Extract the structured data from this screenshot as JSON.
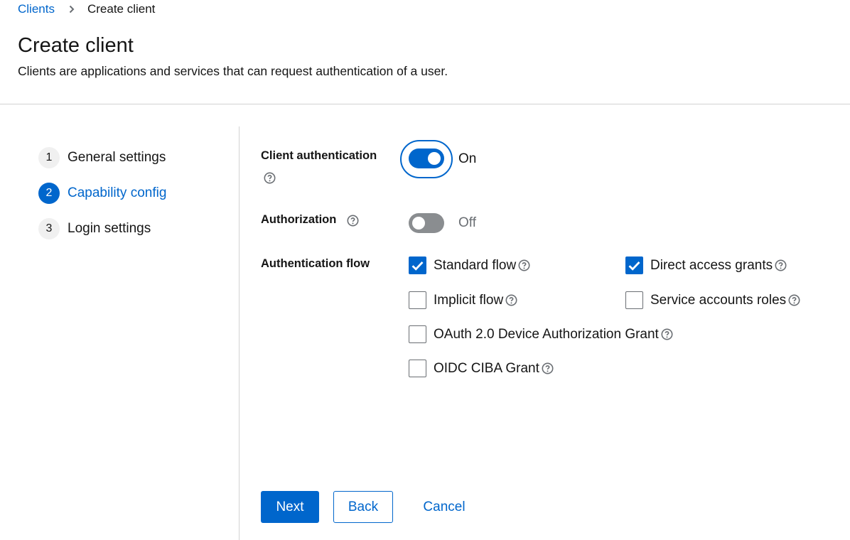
{
  "breadcrumb": {
    "parent": "Clients",
    "current": "Create client"
  },
  "header": {
    "title": "Create client",
    "description": "Clients are applications and services that can request authentication of a user."
  },
  "wizard": {
    "steps": [
      {
        "number": "1",
        "label": "General settings",
        "current": false
      },
      {
        "number": "2",
        "label": "Capability config",
        "current": true
      },
      {
        "number": "3",
        "label": "Login settings",
        "current": false
      }
    ]
  },
  "form": {
    "client_authentication": {
      "label": "Client authentication",
      "state": "On",
      "enabled": true
    },
    "authorization": {
      "label": "Authorization",
      "state": "Off",
      "enabled": false
    },
    "authentication_flow": {
      "label": "Authentication flow",
      "options": [
        {
          "label": "Standard flow",
          "checked": true
        },
        {
          "label": "Direct access grants",
          "checked": true
        },
        {
          "label": "Implicit flow",
          "checked": false
        },
        {
          "label": "Service accounts roles",
          "checked": false
        },
        {
          "label": "OAuth 2.0 Device Authorization Grant",
          "checked": false
        },
        {
          "label": "OIDC CIBA Grant",
          "checked": false
        }
      ]
    }
  },
  "buttons": {
    "next": "Next",
    "back": "Back",
    "cancel": "Cancel"
  },
  "colors": {
    "primary": "#0066cc",
    "text": "#151515",
    "border": "#d2d2d2",
    "switch_off": "#8a8d90"
  },
  "icons": {
    "breadcrumb_separator": "chevron-right-icon",
    "help": "question-circle-icon",
    "check": "checkmark-icon"
  }
}
